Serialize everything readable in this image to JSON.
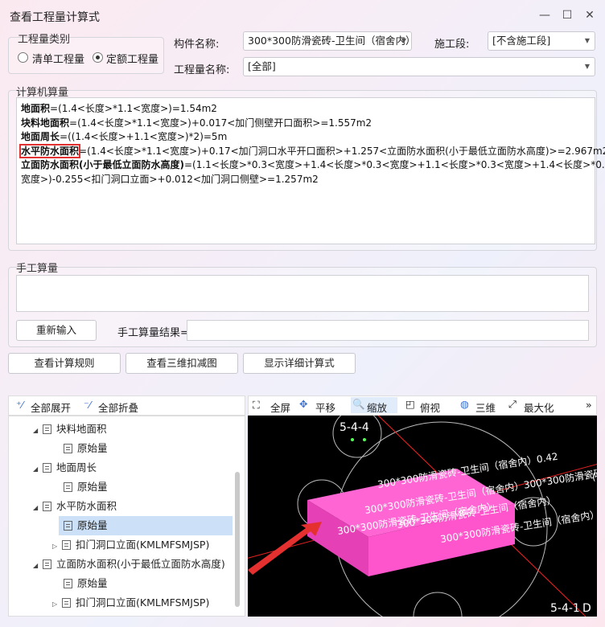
{
  "window": {
    "title": "查看工程量计算式",
    "min": "—",
    "max": "☐",
    "close": "✕"
  },
  "category": {
    "label": "工程量类别",
    "opt1": "清单工程量",
    "opt2": "定额工程量",
    "selected": "定额工程量"
  },
  "component": {
    "label": "构件名称:",
    "value": "300*300防滑瓷砖-卫生间（宿舍内）"
  },
  "stage": {
    "label": "施工段:",
    "value": "[不含施工段]"
  },
  "qtyname": {
    "label": "工程量名称:",
    "value": "[全部]"
  },
  "computer": {
    "label": "计算机算量",
    "l1a": "地面积",
    "l1b": "=(1.4<长度>*1.1<宽度>)=1.54m2",
    "l2a": "块料地面积",
    "l2b": "=(1.4<长度>*1.1<宽度>)+0.017<加门侧壁开口面积>=1.557m2",
    "l3a": "地面周长",
    "l3b": "=((1.4<长度>+1.1<宽度>)*2)=5m",
    "l4a": "水平防水面积",
    "l4b": "=(1.4<长度>*1.1<宽度>)+0.17<加门洞口水平开口面积>+1.257<立面防水面积(小于最低立面防水高度)>=2.967m2",
    "l5a": "立面防水面积(小于最低立面防水高度)",
    "l5b": "=(1.1<长度>*0.3<宽度>+1.4<长度>*0.3<宽度>+1.1<长度>*0.3<宽度>+1.4<长度>*0.3<",
    "l6": "宽度>)-0.255<扣门洞口立面>+0.012<加门洞口侧壁>=1.257m2"
  },
  "manual": {
    "label": "手工算量",
    "reinput": "重新输入",
    "result_label": "手工算量结果="
  },
  "actions": {
    "rules": "查看计算规则",
    "view3d": "查看三维扣减图",
    "detail": "显示详细计算式"
  },
  "tree_toolbar": {
    "expand": "全部展开",
    "collapse": "全部折叠"
  },
  "tree": [
    {
      "label": "块料地面积",
      "level": 1
    },
    {
      "label": "原始量",
      "level": 2
    },
    {
      "label": "地面周长",
      "level": 1
    },
    {
      "label": "原始量",
      "level": 2
    },
    {
      "label": "水平防水面积",
      "level": 1
    },
    {
      "label": "原始量",
      "level": 2,
      "selected": true
    },
    {
      "label": "扣门洞口立面(KMLMFSMJSP)",
      "level": 2,
      "collapsed": true
    },
    {
      "label": "立面防水面积(小于最低立面防水高度)",
      "level": 1
    },
    {
      "label": "原始量",
      "level": 2
    },
    {
      "label": "扣门洞口立面(KMLMFSMJSP)",
      "level": 2,
      "collapsed": true
    }
  ],
  "view_toolbar": {
    "fullscreen": "全屏",
    "pan": "平移",
    "zoom": "缩放",
    "top": "俯视",
    "threed": "三维",
    "maximize": "最大化",
    "more": "»"
  },
  "view3d": {
    "axis_top": "5-4-4",
    "axis_bottom": "5-4-1",
    "axis_bottom2": "D",
    "t1": "300*300防滑瓷砖-卫生间（宿舍内）0.42",
    "t2": "300*300防滑瓷砖-卫生间（宿舍内）300*300防滑瓷砖-卫生间（宿舍内）",
    "t3": "300*300防滑瓷砖-卫生间（宿舍内）1.54",
    "t4": "300*300防滑瓷砖-卫生间（宿舍内）",
    "t5": "300*300防滑瓷砖-卫生间（宿舍内）",
    "t6": "(",
    "colors": {
      "slab": "#ff5fd2",
      "slab_side": "#e23db4",
      "arrow": "#e53030",
      "line": "#ff2020"
    }
  }
}
